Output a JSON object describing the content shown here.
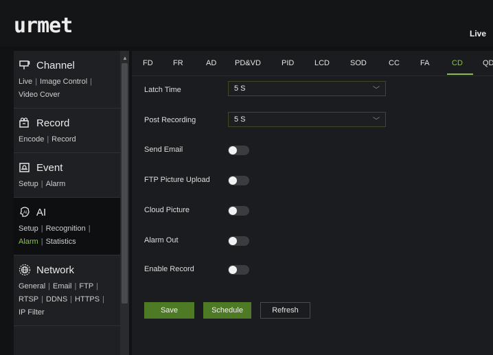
{
  "header": {
    "logo": "urmet",
    "live_label": "Live"
  },
  "sidebar": {
    "sections": [
      {
        "title": "Channel",
        "icon": "channel-icon",
        "links": [
          "Live",
          "Image Control",
          "Video Cover"
        ]
      },
      {
        "title": "Record",
        "icon": "record-icon",
        "links": [
          "Encode",
          "Record"
        ]
      },
      {
        "title": "Event",
        "icon": "event-icon",
        "links": [
          "Setup",
          "Alarm"
        ]
      },
      {
        "title": "AI",
        "icon": "ai-icon",
        "links": [
          "Setup",
          "Recognition",
          "Alarm",
          "Statistics"
        ],
        "active_link": "Alarm"
      },
      {
        "title": "Network",
        "icon": "network-icon",
        "links": [
          "General",
          "Email",
          "FTP",
          "RTSP",
          "DDNS",
          "HTTPS",
          "IP Filter"
        ]
      }
    ]
  },
  "tabs": [
    "FD",
    "FR",
    "AD",
    "PD&VD",
    "PID",
    "LCD",
    "SOD",
    "CC",
    "FA",
    "CD",
    "QD"
  ],
  "active_tab": "CD",
  "form": {
    "latch_time_label": "Latch Time",
    "latch_time_value": "5 S",
    "post_recording_label": "Post Recording",
    "post_recording_value": "5 S",
    "send_email_label": "Send Email",
    "ftp_picture_upload_label": "FTP Picture Upload",
    "cloud_picture_label": "Cloud Picture",
    "alarm_out_label": "Alarm Out",
    "enable_record_label": "Enable Record"
  },
  "toggles": {
    "send_email": false,
    "ftp_picture_upload": false,
    "cloud_picture": false,
    "alarm_out": false,
    "enable_record": false
  },
  "buttons": {
    "save": "Save",
    "schedule": "Schedule",
    "refresh": "Refresh"
  },
  "colors": {
    "accent": "#8bc34a",
    "button_green": "#4f7a25",
    "background": "#111214"
  }
}
